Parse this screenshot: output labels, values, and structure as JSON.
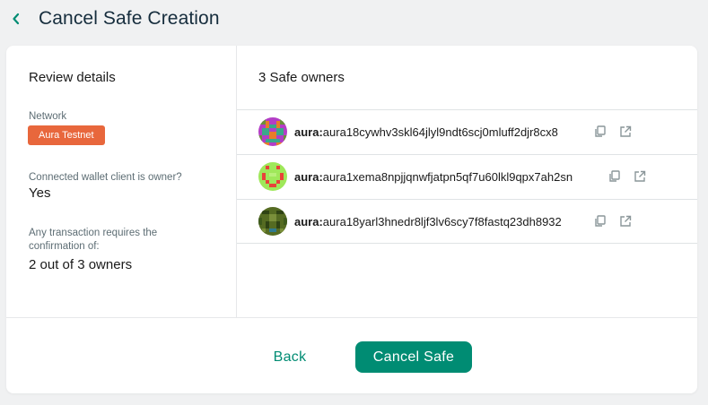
{
  "header": {
    "title": "Cancel Safe Creation",
    "back_icon": "chevron-left-icon"
  },
  "review": {
    "title": "Review details",
    "network_label": "Network",
    "network_value": "Aura Testnet",
    "owner_question": "Connected wallet client is owner?",
    "owner_answer": "Yes",
    "confirm_label_line1": "Any transaction requires the",
    "confirm_label_line2": "confirmation of:",
    "confirm_value": "2 out of 3 owners"
  },
  "owners": {
    "title": "3 Safe owners",
    "items": [
      {
        "prefix": "aura:",
        "address": "aura18cywhv3skl64jlyl9ndt6scj0mluff2djr8cx8"
      },
      {
        "prefix": "aura:",
        "address": "aura1xema8npjjqnwfjatpn5qf7u60lkl9qpx7ah2sn"
      },
      {
        "prefix": "aura:",
        "address": "aura18yarl3hnedr8ljf3lv6scy7f8fastq23dh8932"
      }
    ]
  },
  "footer": {
    "back_label": "Back",
    "cancel_label": "Cancel Safe"
  },
  "colors": {
    "accent": "#008c73",
    "network_badge": "#e8673c"
  }
}
